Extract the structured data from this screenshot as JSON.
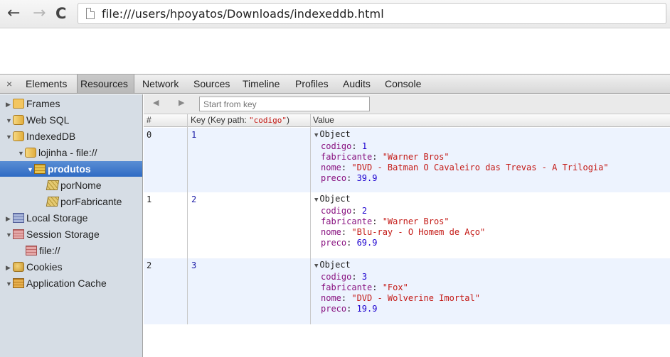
{
  "browser": {
    "back_glyph": "←",
    "forward_glyph": "→",
    "reload_glyph": "C",
    "address": "file:///users/hpoyatos/Downloads/indexeddb.html"
  },
  "devtools": {
    "close_glyph": "×",
    "tabs": [
      "Elements",
      "Resources",
      "Network",
      "Sources",
      "Timeline",
      "Profiles",
      "Audits",
      "Console"
    ],
    "selected_tab": "Resources"
  },
  "sidebar": {
    "items": [
      {
        "label": "Frames",
        "icon": "folder-icon",
        "expanded": false
      },
      {
        "label": "Web SQL",
        "icon": "database-icon",
        "expanded": true
      },
      {
        "label": "IndexedDB",
        "icon": "database-icon",
        "expanded": true
      },
      {
        "label": "lojinha - file://",
        "icon": "database-icon",
        "expanded": true
      },
      {
        "label": "produtos",
        "icon": "object-store-icon",
        "expanded": true,
        "selected": true
      },
      {
        "label": "porNome",
        "icon": "index-icon"
      },
      {
        "label": "porFabricante",
        "icon": "index-icon"
      },
      {
        "label": "Local Storage",
        "icon": "local-storage-icon",
        "expanded": false
      },
      {
        "label": "Session Storage",
        "icon": "session-storage-icon",
        "expanded": true
      },
      {
        "label": "file://",
        "icon": "session-storage-icon"
      },
      {
        "label": "Cookies",
        "icon": "cookie-icon",
        "expanded": false
      },
      {
        "label": "Application Cache",
        "icon": "app-cache-icon",
        "expanded": true
      }
    ]
  },
  "toolbar": {
    "prev_glyph": "◀",
    "next_glyph": "▶",
    "start_key_placeholder": "Start from key"
  },
  "table": {
    "headers": {
      "num": "#",
      "key_prefix": "Key (Key path: ",
      "key_path": "\"codigo\"",
      "key_suffix": ")",
      "value": "Value"
    },
    "rows": [
      {
        "num": "0",
        "key": "1",
        "object_label": "Object",
        "codigo_name": "codigo",
        "codigo": "1",
        "fabricante_name": "fabricante",
        "fabricante": "\"Warner Bros\"",
        "nome_name": "nome",
        "nome": "\"DVD - Batman O Cavaleiro das Trevas - A Trilogia\"",
        "preco_name": "preco",
        "preco": "39.9"
      },
      {
        "num": "1",
        "key": "2",
        "object_label": "Object",
        "codigo_name": "codigo",
        "codigo": "2",
        "fabricante_name": "fabricante",
        "fabricante": "\"Warner Bros\"",
        "nome_name": "nome",
        "nome": "\"Blu-ray - O Homem de Aço\"",
        "preco_name": "preco",
        "preco": "69.9"
      },
      {
        "num": "2",
        "key": "3",
        "object_label": "Object",
        "codigo_name": "codigo",
        "codigo": "3",
        "fabricante_name": "fabricante",
        "fabricante": "\"Fox\"",
        "nome_name": "nome",
        "nome": "\"DVD - Wolverine Imortal\"",
        "preco_name": "preco",
        "preco": "19.9"
      }
    ]
  }
}
